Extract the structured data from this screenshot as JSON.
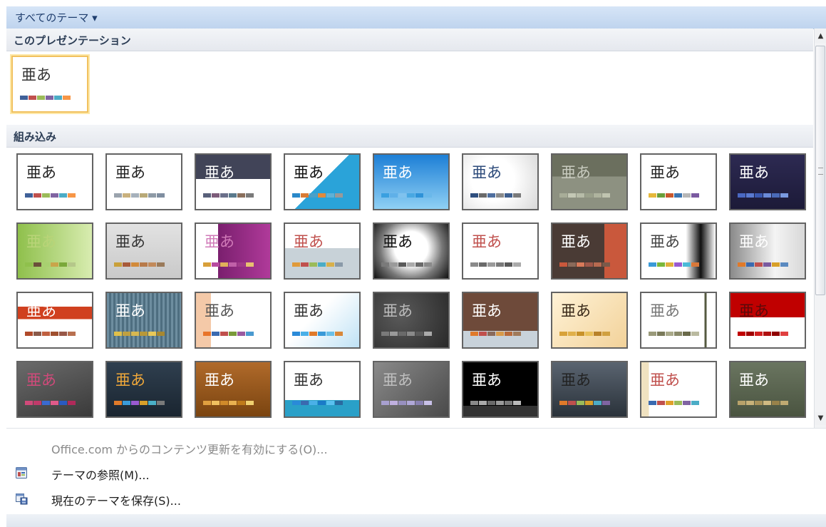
{
  "header": {
    "title": "すべてのテーマ ▾"
  },
  "sections": {
    "this_presentation": "このプレゼンテーション",
    "builtin": "組み込み"
  },
  "current_theme": {
    "text": "亜あ",
    "text_color": "#333333",
    "bg": "#ffffff",
    "swatches": [
      "#3f6098",
      "#c0504d",
      "#9bbb59",
      "#8064a2",
      "#4bacc6",
      "#f79646"
    ]
  },
  "themes": [
    {
      "text": "亜あ",
      "text_color": "#222222",
      "bg": "#ffffff",
      "swatches": [
        "#3f6098",
        "#c0504d",
        "#9bbb59",
        "#8064a2",
        "#4bacc6",
        "#f79646"
      ]
    },
    {
      "text": "亜あ",
      "text_color": "#222222",
      "bg": "#ffffff",
      "swatches": [
        "#9aa3ad",
        "#c9b17e",
        "#a6b1bb",
        "#b8a978",
        "#8e9aa6",
        "#7f8ea0"
      ]
    },
    {
      "text": "亜あ",
      "text_color": "#ffffff",
      "bg": "linear-gradient(#414458 0 45%, #ffffff 45%)",
      "swatches": [
        "#59607a",
        "#7d5c7a",
        "#6a6f8a",
        "#5a7a8c",
        "#8a6f5c",
        "#7a7a7a"
      ]
    },
    {
      "text": "亜あ",
      "text_color": "#111111",
      "bg": "linear-gradient(135deg, #ffffff 50%, #2aa3d9 50%)",
      "swatches": [
        "#2a88c9",
        "#d97b35",
        "#4aa0c8",
        "#e08a3c",
        "#5fb1d6",
        "#999999"
      ]
    },
    {
      "text": "亜あ",
      "text_color": "#ffffff",
      "bg": "linear-gradient(#1d7fd6, #8fd0f4)",
      "swatches": [
        "#3aa0e0",
        "#5fb0e8",
        "#7fc2ee",
        "#48a8e2",
        "#2e92d8",
        "#6ab8ea"
      ]
    },
    {
      "text": "亜あ",
      "text_color": "#2c4a7a",
      "bg": "radial-gradient(circle at 40% 45%, #ffffff 40%, #d8d8d8)",
      "swatches": [
        "#2f4f7f",
        "#6a6a6a",
        "#4f6f9f",
        "#8a8a8a",
        "#3f5f8f",
        "#7a7a7a"
      ]
    },
    {
      "text": "亜あ",
      "text_color": "#c8cbbf",
      "bg": "linear-gradient(#6b6f5e 0 40%, #8d9181 40%)",
      "swatches": [
        "#a8ad98",
        "#c4c8b5",
        "#b7bca8",
        "#9aa08b",
        "#aeb39e",
        "#c0c4b0"
      ]
    },
    {
      "text": "亜あ",
      "text_color": "#222222",
      "bg": "#ffffff",
      "swatches": [
        "#e6b83a",
        "#6a9f3a",
        "#c9582c",
        "#3a74b0",
        "#b7b7b7",
        "#7a5aa0"
      ]
    },
    {
      "text": "亜あ",
      "text_color": "#ffffff",
      "bg": "linear-gradient(#2d2a52, #1c1a38)",
      "swatches": [
        "#4a68c2",
        "#5a7ad0",
        "#3a58b0",
        "#6a8ad8",
        "#4a6ab8",
        "#7a9ae0"
      ]
    },
    {
      "text": "亜あ",
      "text_color": "#b9d478",
      "bg": "linear-gradient(90deg, #8fc04c, #d8ecb0)",
      "swatches": [
        "#8fc04c",
        "#6b4f3a",
        "#a8d070",
        "#c9a54a",
        "#7aa83a",
        "#b5c78a"
      ]
    },
    {
      "text": "亜あ",
      "text_color": "#333333",
      "bg": "linear-gradient(#e2e2e2, #c9c9c9)",
      "swatches": [
        "#c9a03a",
        "#a85a3a",
        "#d28a3a",
        "#b87a4a",
        "#c28a5a",
        "#9a7a5a"
      ]
    },
    {
      "text": "亜あ",
      "text_color": "#d07ab8",
      "bg": "linear-gradient(90deg, #ffffff 0 30%, #7a1f6e 30%, #b03a9a)",
      "swatches": [
        "#d8a03a",
        "#b84aa0",
        "#e0b05a",
        "#c060a8",
        "#a03a8a",
        "#e8c070"
      ]
    },
    {
      "text": "亜あ",
      "text_color": "#c0504d",
      "bg": "linear-gradient(#ffffff 0 45%, #c8d2d8 45%)",
      "swatches": [
        "#e09a3a",
        "#c0504d",
        "#9bbb59",
        "#4bacc6",
        "#d8b04a",
        "#8a9aa8"
      ]
    },
    {
      "text": "亜あ",
      "text_color": "#111111",
      "bg": "radial-gradient(circle at 50% 45%, #ffffff 35%, #777777 65%, #111111)",
      "swatches": [
        "#7a7a7a",
        "#9a9a9a",
        "#5a5a5a",
        "#aaaaaa",
        "#6a6a6a",
        "#8a8a8a"
      ]
    },
    {
      "text": "亜あ",
      "text_color": "#c0504d",
      "bg": "#ffffff",
      "swatches": [
        "#8a8a8a",
        "#6a6a6a",
        "#9a9a9a",
        "#7a7a7a",
        "#5a5a5a",
        "#aaaaaa"
      ]
    },
    {
      "text": "亜あ",
      "text_color": "#ffffff",
      "bg": "linear-gradient(90deg, #4a3b35 0 70%, #c9583c 70%)",
      "swatches": [
        "#c9583c",
        "#8a6a5a",
        "#d87a5a",
        "#a0584a",
        "#b86a50",
        "#7a5a4a"
      ]
    },
    {
      "text": "亜あ",
      "text_color": "#444444",
      "bg": "linear-gradient(90deg, #ffffff 0 60%, #111111 80%, #ffffff)",
      "swatches": [
        "#3a9ad8",
        "#7ab83a",
        "#e0b03a",
        "#9a5ad0",
        "#4abad8",
        "#d8783a"
      ]
    },
    {
      "text": "亜あ",
      "text_color": "#ffffff",
      "bg": "linear-gradient(90deg, #8a8a8a, #f4f4f4 60%, #d8d8d8)",
      "swatches": [
        "#e07a2a",
        "#3a6ab0",
        "#c0504d",
        "#7a5aa0",
        "#d8a02a",
        "#5a8ac0"
      ]
    },
    {
      "text": "亜あ",
      "text_color": "#ffffff",
      "bg": "linear-gradient(#ffffff 0 25%, #d0401f 25% 48%, #ffffff 48%)",
      "swatches": [
        "#b04a2a",
        "#8a5a4a",
        "#c06040",
        "#a05030",
        "#985848",
        "#b87050"
      ]
    },
    {
      "text": "亜あ",
      "text_color": "#ffffff",
      "bg": "repeating-linear-gradient(90deg, #6e8ea0 0 3px, #4e6e80 3px 6px)",
      "swatches": [
        "#e0c04a",
        "#c0a040",
        "#d8b850",
        "#b89838",
        "#e8c858",
        "#a88830"
      ]
    },
    {
      "text": "亜あ",
      "text_color": "#555555",
      "bg": "linear-gradient(90deg, #f4c9a8 0 20%, #ffffff 20%)",
      "swatches": [
        "#e8742a",
        "#3a6ab0",
        "#c0504d",
        "#7a9a3a",
        "#9a5aa0",
        "#4a9ad0"
      ]
    },
    {
      "text": "亜あ",
      "text_color": "#333333",
      "bg": "linear-gradient(135deg, #ffffff 40%, #bfe2f5)",
      "swatches": [
        "#2a8ad8",
        "#4ab0e8",
        "#e07a2a",
        "#3a9ad8",
        "#6ac0e8",
        "#d8883a"
      ]
    },
    {
      "text": "亜あ",
      "text_color": "#bbbbbb",
      "bg": "radial-gradient(circle at 35% 40%, #5a5a5a, #2a2a2a)",
      "swatches": [
        "#7a7a7a",
        "#9a9a9a",
        "#6a6a6a",
        "#8a8a8a",
        "#5a5a5a",
        "#aaaaaa"
      ]
    },
    {
      "text": "亜あ",
      "text_color": "#ffffff",
      "bg": "linear-gradient(#6e4a3a 0 70%, #c8d2da 70%)",
      "swatches": [
        "#e07a2a",
        "#c0504d",
        "#8a6a5a",
        "#d89a4a",
        "#b86a3a",
        "#a07a5a"
      ]
    },
    {
      "text": "亜あ",
      "text_color": "#3a2a1a",
      "bg": "linear-gradient(135deg, #fff2d6, #f2d29a)",
      "swatches": [
        "#d8a23a",
        "#e0b04a",
        "#c8922a",
        "#e8c05a",
        "#b8822a",
        "#d0a040"
      ]
    },
    {
      "text": "亜あ",
      "text_color": "#777777",
      "bg": "linear-gradient(90deg, #ffffff 0 85%, #555a40 85% 88%, #ffffff 88%)",
      "swatches": [
        "#9a9a7a",
        "#7a7a5a",
        "#aaaa8a",
        "#8a8a6a",
        "#6a6a4a",
        "#babaa0"
      ]
    },
    {
      "text": "亜あ",
      "text_color": "#5a0a0a",
      "bg": "linear-gradient(#c00000 0 45%, #ffffff 45%)",
      "swatches": [
        "#c00000",
        "#a00000",
        "#d02020",
        "#b01010",
        "#900000",
        "#e04040"
      ]
    },
    {
      "text": "亜あ",
      "text_color": "#d04a7a",
      "bg": "linear-gradient(160deg, #6a6a6a, #3a3a3a)",
      "swatches": [
        "#d04a7a",
        "#c03a6a",
        "#3a6ad0",
        "#e05a8a",
        "#2a5ac0",
        "#b02a5a"
      ]
    },
    {
      "text": "亜あ",
      "text_color": "#f0a83a",
      "bg": "linear-gradient(#2f3f4f, #1a2530)",
      "swatches": [
        "#e07a2a",
        "#3a9ad8",
        "#9a5ad0",
        "#d8a02a",
        "#4ab0c8",
        "#7a7a7a"
      ]
    },
    {
      "text": "亜あ",
      "text_color": "#ffffff",
      "bg": "linear-gradient(#b06a2a, #7a4410)",
      "swatches": [
        "#e0a040",
        "#f0c060",
        "#d08a2a",
        "#e8b050",
        "#c07a1a",
        "#f0d070"
      ]
    },
    {
      "text": "亜あ",
      "text_color": "#333333",
      "bg": "linear-gradient(#ffffff 0 70%, #2aa0c8 70%)",
      "swatches": [
        "#2a8ad8",
        "#3a6ab0",
        "#4ab0e8",
        "#1a7ac8",
        "#5ac0f0",
        "#2a6aa0"
      ]
    },
    {
      "text": "亜あ",
      "text_color": "#bfbfbf",
      "bg": "linear-gradient(135deg, #8a8a8a, #4a4a4a)",
      "swatches": [
        "#a8a0d0",
        "#c0b0e0",
        "#9890c0",
        "#b0a8d8",
        "#8880b0",
        "#c8c0e8"
      ]
    },
    {
      "text": "亜あ",
      "text_color": "#ffffff",
      "bg": "linear-gradient(#000000 0 80%, #333333 80%)",
      "swatches": [
        "#8a8a8a",
        "#aaaaaa",
        "#6a6a6a",
        "#9a9a9a",
        "#7a7a7a",
        "#bababa"
      ]
    },
    {
      "text": "亜あ",
      "text_color": "#222222",
      "bg": "linear-gradient(#5a6470, #2a323a)",
      "swatches": [
        "#e07a2a",
        "#c0504d",
        "#9bbb59",
        "#d8a02a",
        "#4bacc6",
        "#8064a2"
      ]
    },
    {
      "text": "亜あ",
      "text_color": "#c0504d",
      "bg": "linear-gradient(90deg, #f0e2c0 0 10%, #ffffff 10%)",
      "swatches": [
        "#3a6ab0",
        "#c0504d",
        "#e0a02a",
        "#9bbb59",
        "#8064a2",
        "#4bacc6"
      ]
    },
    {
      "text": "亜あ",
      "text_color": "#ffffff",
      "bg": "linear-gradient(#6a7560, #4a5440)",
      "swatches": [
        "#b8a26a",
        "#c8b27a",
        "#a8925a",
        "#d0ba82",
        "#98824a",
        "#c0aa72"
      ]
    }
  ],
  "menu": {
    "enable_updates": "Office.com からのコンテンツ更新を有効にする(O)...",
    "browse": "テーマの参照(M)...",
    "save": "現在のテーマを保存(S)..."
  }
}
